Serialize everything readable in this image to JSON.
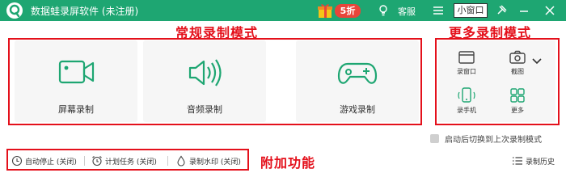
{
  "titlebar": {
    "app_title": "数据蛙录屏软件 (未注册)",
    "promo_badge": "5折",
    "service_label": "客服",
    "mini_window_label": "小窗口"
  },
  "annotations": {
    "regular_modes": "常规录制模式",
    "more_modes": "更多录制模式",
    "extra_features": "附加功能"
  },
  "modes": [
    {
      "label": "屏幕录制",
      "icon": "video-camera-icon"
    },
    {
      "label": "音频录制",
      "icon": "speaker-icon"
    },
    {
      "label": "游戏录制",
      "icon": "gamepad-icon"
    }
  ],
  "more": [
    {
      "label": "录窗口",
      "icon": "window-icon"
    },
    {
      "label": "截图",
      "icon": "camera-icon"
    },
    {
      "label": "录手机",
      "icon": "phone-icon"
    },
    {
      "label": "更多",
      "icon": "grid-icon"
    }
  ],
  "options": {
    "switch_last_mode": "启动后切换到上次录制模式"
  },
  "bottom": {
    "auto_stop": "自动停止 (关闭)",
    "scheduled_task": "计划任务 (关闭)",
    "watermark": "录制水印 (关闭)",
    "history": "录制历史"
  },
  "colors": {
    "brand_green": "#1ea672",
    "annotation_red": "#e4101b",
    "promo_red": "#e8453a"
  }
}
